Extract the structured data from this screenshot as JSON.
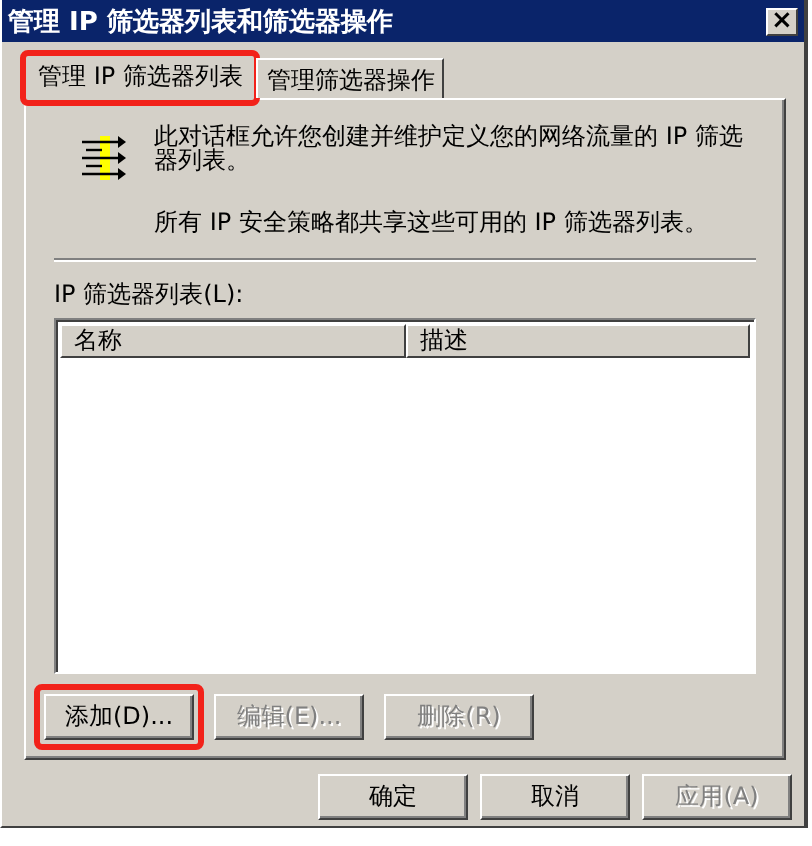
{
  "window": {
    "title": "管理 IP 筛选器列表和筛选器操作",
    "close": "×"
  },
  "tabs": [
    {
      "label": "管理 IP 筛选器列表",
      "selected": true,
      "highlighted": true
    },
    {
      "label": "管理筛选器操作",
      "selected": false,
      "highlighted": false
    }
  ],
  "intro": [
    "此对话框允许您创建并维护定义您的网络流量的 IP 筛选器列表。",
    "所有 IP 安全策略都共享这些可用的 IP 筛选器列表。"
  ],
  "list": {
    "label": "IP 筛选器列表(L):",
    "columns": [
      "名称",
      "描述"
    ]
  },
  "list_buttons": [
    {
      "label": "添加(D)...",
      "disabled": false,
      "highlighted": true
    },
    {
      "label": "编辑(E)...",
      "disabled": true,
      "highlighted": false
    },
    {
      "label": "删除(R)",
      "disabled": true,
      "highlighted": false
    }
  ],
  "dialog_buttons": [
    {
      "label": "确定",
      "disabled": false
    },
    {
      "label": "取消",
      "disabled": false
    },
    {
      "label": "应用(A)",
      "disabled": true
    }
  ]
}
